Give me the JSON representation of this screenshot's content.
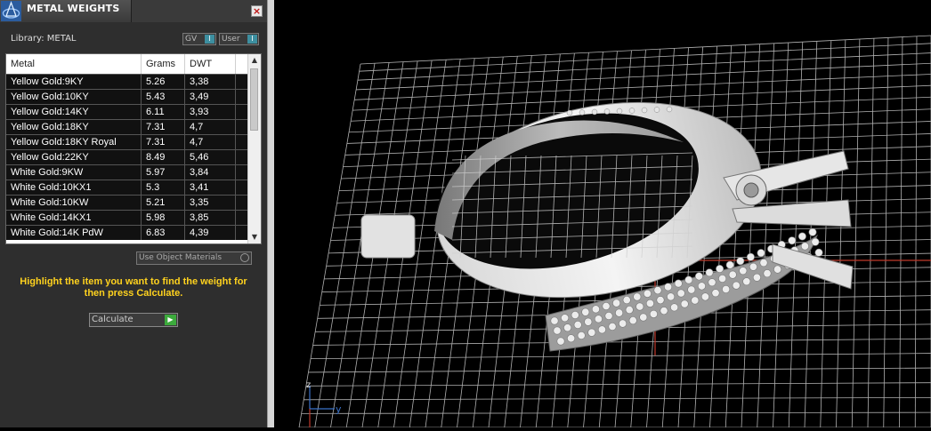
{
  "panel": {
    "title": "METAL WEIGHTS",
    "close_label": "×",
    "library_label": "Library: METAL",
    "toggles": {
      "gv_label": "GV",
      "user_label": "User"
    },
    "table": {
      "headers": [
        "Metal",
        "Grams",
        "DWT"
      ],
      "rows": [
        [
          "Yellow Gold:9KY",
          "5.26",
          "3,38"
        ],
        [
          "Yellow Gold:10KY",
          "5.43",
          "3,49"
        ],
        [
          "Yellow Gold:14KY",
          "6.11",
          "3,93"
        ],
        [
          "Yellow Gold:18KY",
          "7.31",
          "4,7"
        ],
        [
          "Yellow Gold:18KY Royal",
          "7.31",
          "4,7"
        ],
        [
          "Yellow Gold:22KY",
          "8.49",
          "5,46"
        ],
        [
          "White Gold:9KW",
          "5.97",
          "3,84"
        ],
        [
          "White Gold:10KX1",
          "5.3",
          "3,41"
        ],
        [
          "White Gold:10KW",
          "5.21",
          "3,35"
        ],
        [
          "White Gold:14KX1",
          "5.98",
          "3,85"
        ],
        [
          "White Gold:14K PdW",
          "6.83",
          "4,39"
        ]
      ]
    },
    "use_object_materials_label": "Use Object Materials",
    "instruction": "Highlight the item you want to find the weight for then press Calculate.",
    "calculate_label": "Calculate"
  },
  "viewport": {
    "axis_z": "z",
    "axis_y": "y",
    "grid_color": "#ffffff",
    "axis_colors": {
      "z": "#3b73c9",
      "y": "#3b73c9",
      "x": "#c0392b"
    }
  }
}
